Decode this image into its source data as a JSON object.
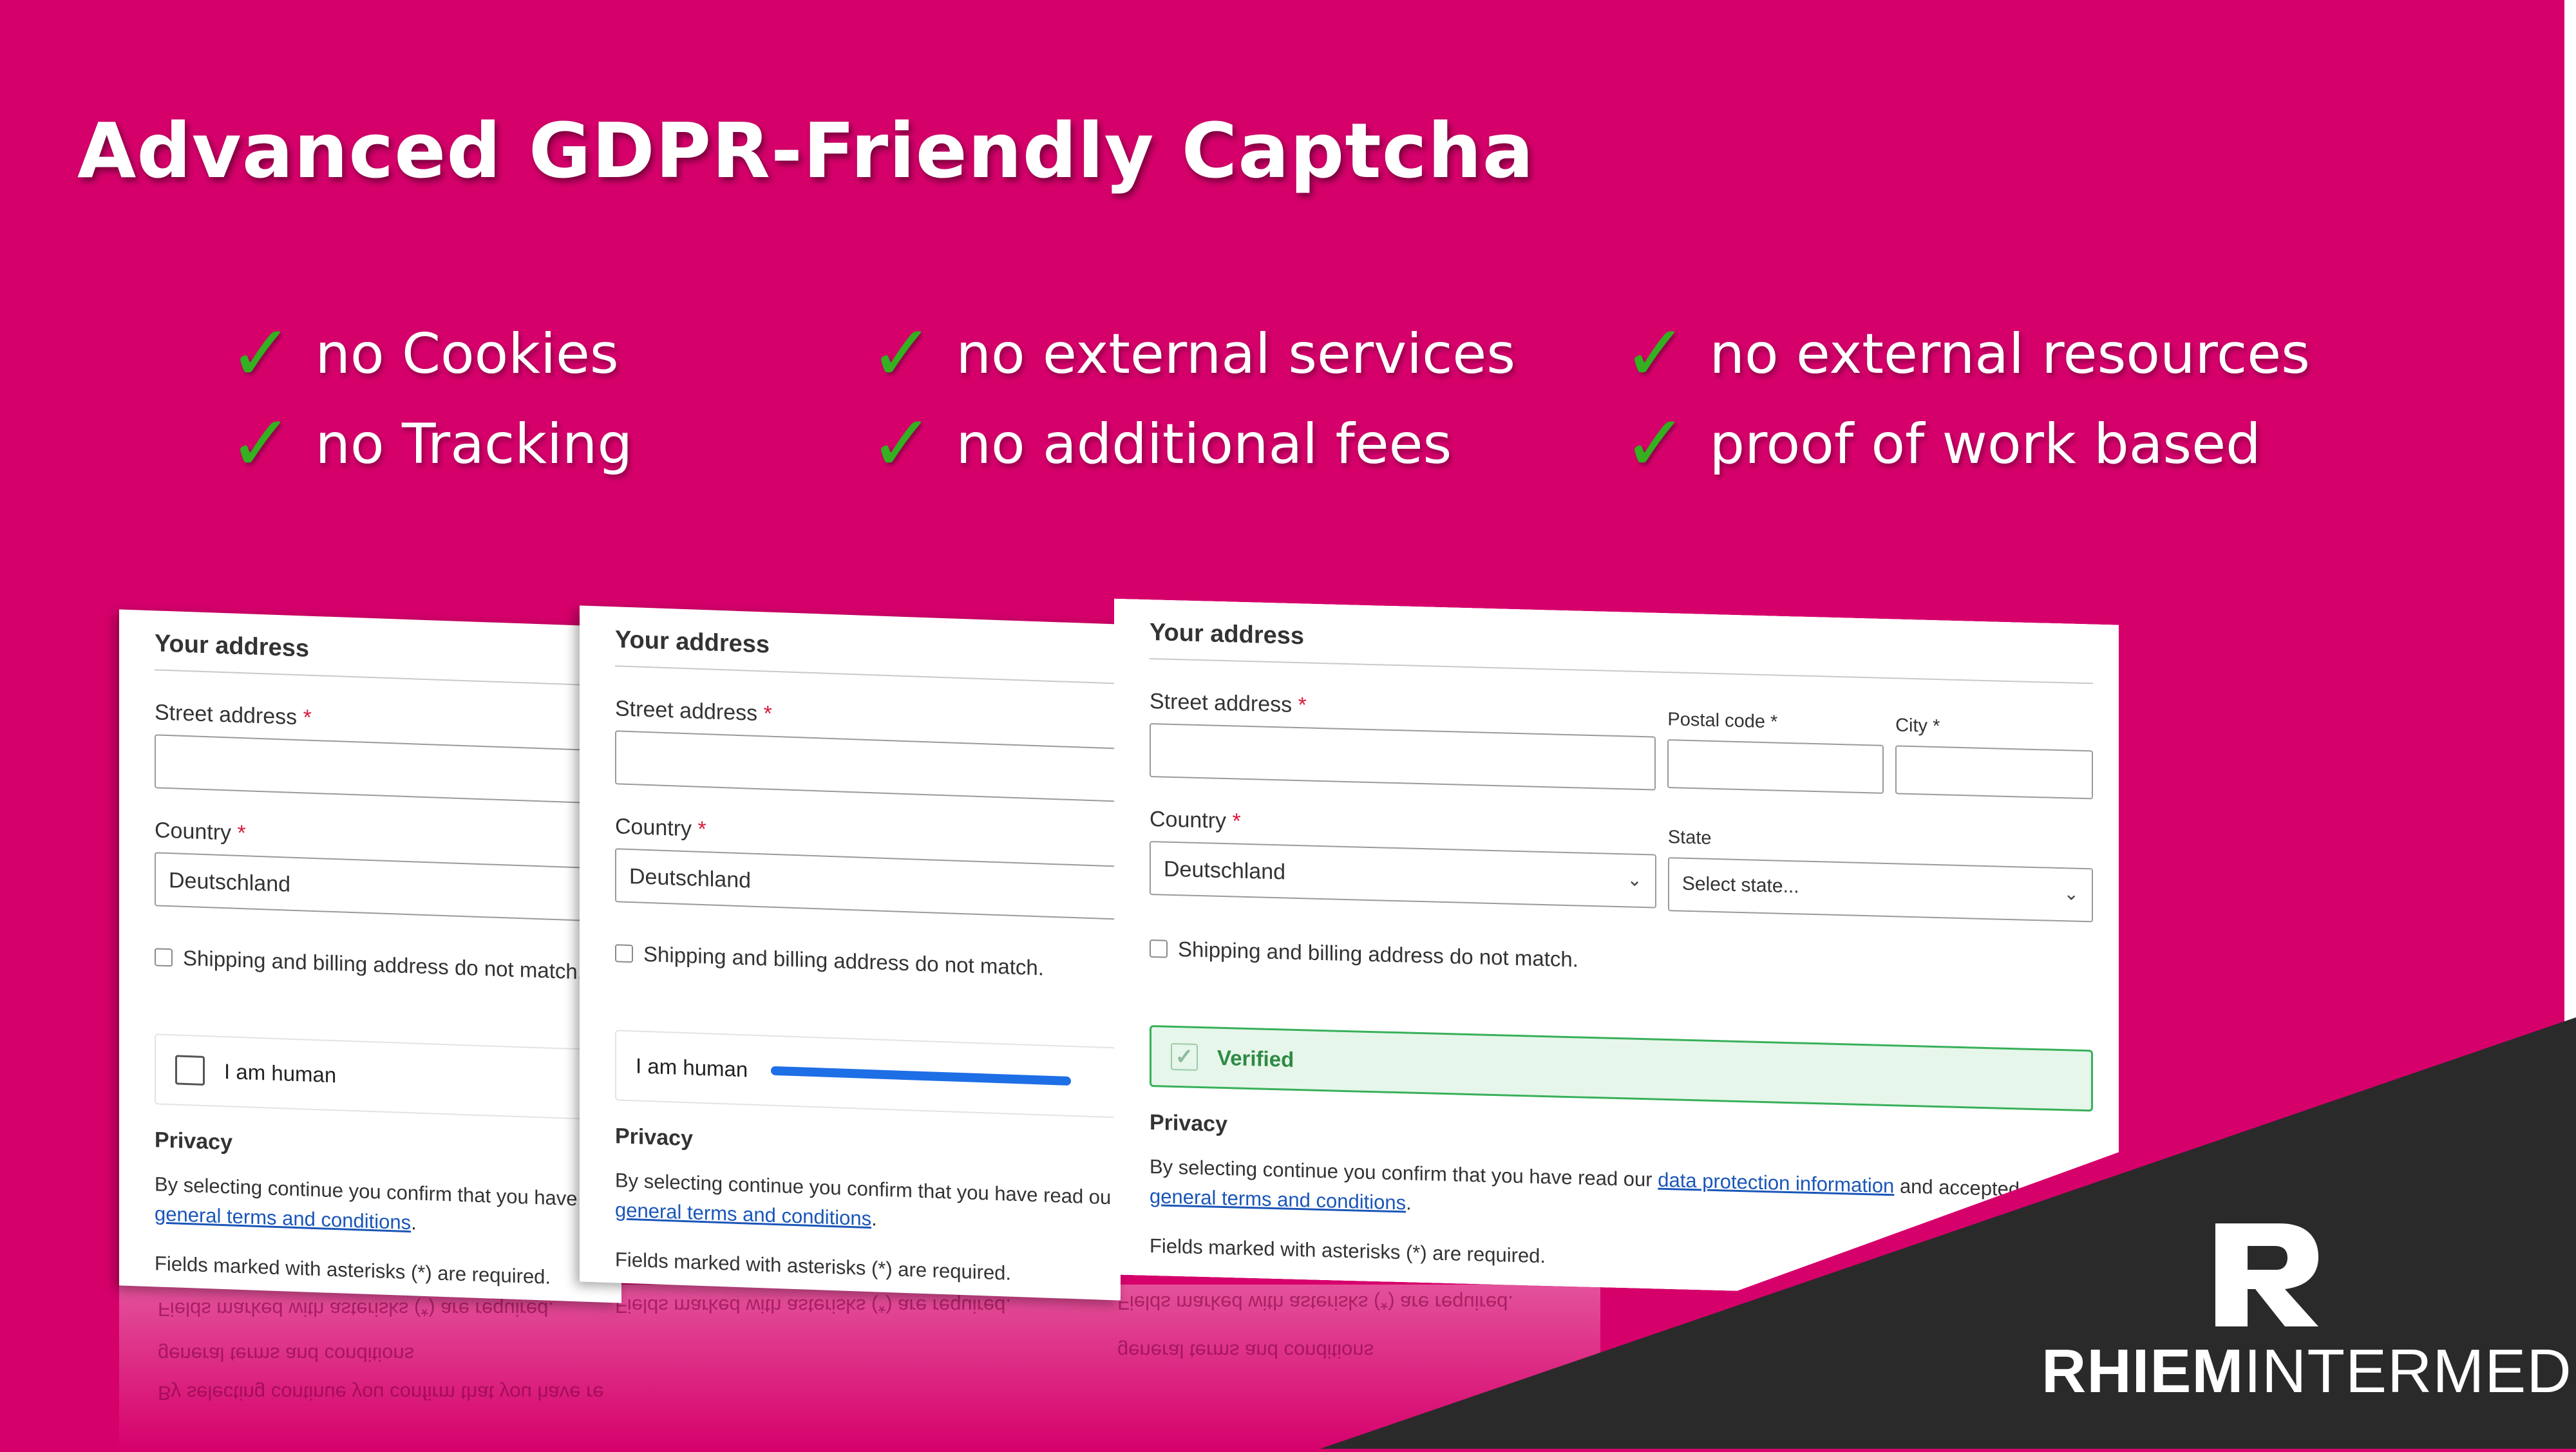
{
  "headline": "Advanced GDPR-Friendly Captcha",
  "check_glyph": "✓",
  "features": [
    "no Cookies",
    "no Tracking",
    "no external services",
    "no additional fees",
    "no external resources",
    "proof of work based"
  ],
  "form": {
    "section_title": "Your address",
    "street_label": "Street address",
    "required_mark": "*",
    "postal_label": "Postal code",
    "city_label": "City",
    "country_label": "Country",
    "country_value": "Deutschland",
    "state_label": "State",
    "state_placeholder": "Select state...",
    "mismatch_label": "Shipping and billing address do not match.",
    "captcha_label": "I am human",
    "verified_label": "Verified",
    "privacy_title": "Privacy",
    "privacy_text_1": "By selecting continue you confirm that you have read our",
    "privacy_text_1_short_a": "By selecting continue you confirm that you have re",
    "privacy_text_1_short_b": "By selecting continue you confirm that you have read ou",
    "privacy_link_data": "data protection information",
    "privacy_text_2": "and accepted our",
    "privacy_link_terms": "general terms and conditions",
    "privacy_period": ".",
    "required_note": "Fields marked with asterisks (*) are required."
  },
  "logo": {
    "bold": "RHIEM",
    "light": "INTERMEDIA"
  },
  "colors": {
    "background": "#d6006b",
    "check": "#34b020",
    "corner": "#2a2a2a",
    "progress": "#1e6ee6",
    "verified_border": "#38b05a"
  },
  "captcha_progress": 0.95
}
